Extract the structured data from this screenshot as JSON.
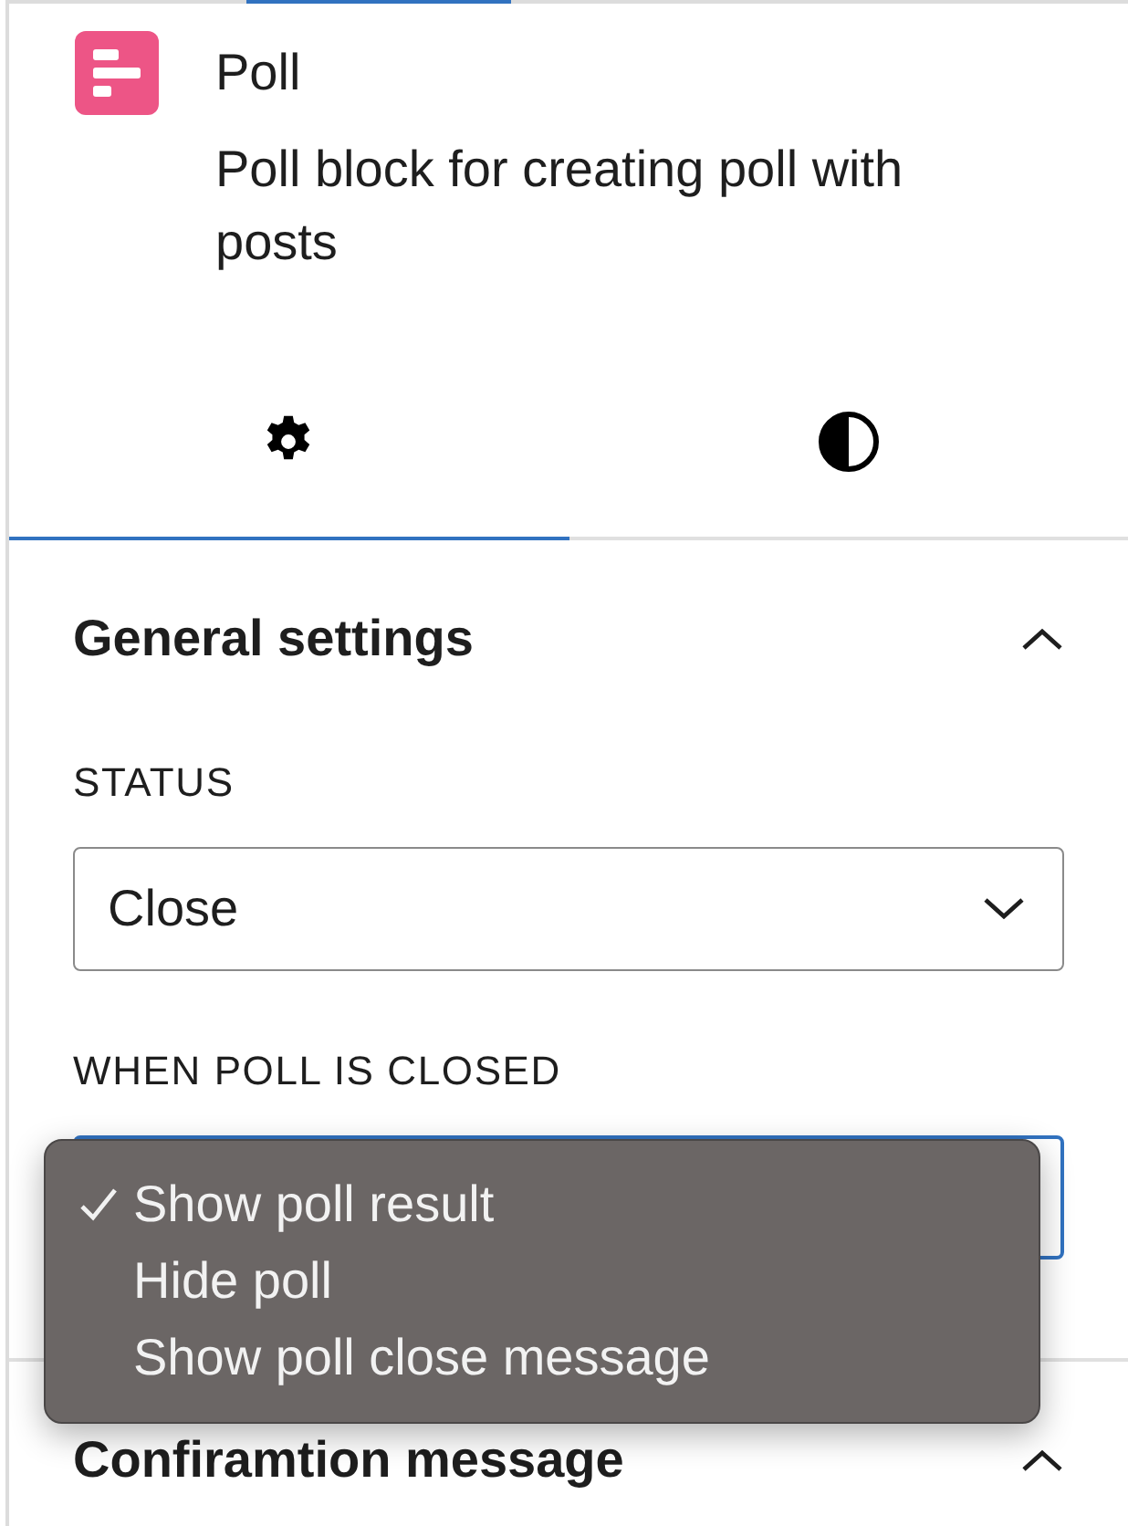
{
  "header": {
    "title": "Poll",
    "description": "Poll block for creating poll with posts"
  },
  "tabs": [
    {
      "kind": "settings",
      "selected": true
    },
    {
      "kind": "styles",
      "selected": false
    }
  ],
  "panels": [
    {
      "title": "General settings",
      "expanded": true,
      "fields": [
        {
          "label": "STATUS",
          "value": "Close",
          "focused": false
        },
        {
          "label": "WHEN POLL IS CLOSED",
          "focused": true,
          "menu": [
            {
              "label": "Show poll result",
              "selected": true
            },
            {
              "label": "Hide poll",
              "selected": false
            },
            {
              "label": "Show poll close message",
              "selected": false
            }
          ]
        }
      ]
    },
    {
      "title": "Confiramtion message",
      "expanded": true
    }
  ]
}
